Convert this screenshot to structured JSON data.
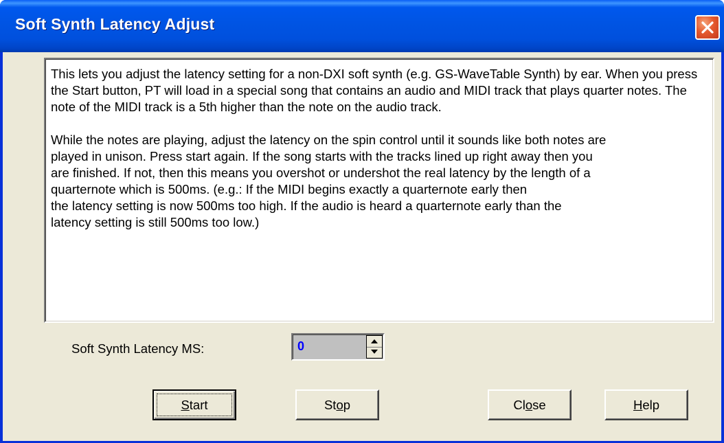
{
  "window": {
    "title": "Soft Synth Latency Adjust"
  },
  "icons": {
    "close": "close-icon",
    "spin_up": "arrow-up-icon",
    "spin_down": "arrow-down-icon"
  },
  "info": {
    "paragraph1": "This lets you adjust the latency setting for a non-DXI soft synth (e.g.  GS-WaveTable Synth) by ear. When you press the Start button, PT will load in a special song that contains an audio and MIDI track that plays quarter notes. The note of the MIDI track is a 5th higher than the note on the audio track.",
    "paragraph2_lines": [
      "While the notes are playing, adjust the latency on the spin control until it sounds like both notes are",
      "played in unison. Press start again. If the song starts with the tracks lined up right away  then you",
      "are finished.  If not, then this means you overshot or undershot the real latency  by the length of a",
      "quarternote which is 500ms.  (e.g.: If the MIDI begins exactly  a quarternote early then",
      "the latency setting is now 500ms too high.  If the audio is heard a quarternote early than the",
      "latency setting is still 500ms too low.)"
    ]
  },
  "latency": {
    "label": "Soft Synth Latency MS:",
    "value": "0"
  },
  "buttons": {
    "start": {
      "mnemonic": "S",
      "rest": "tart"
    },
    "stop": {
      "pre": "St",
      "mnemonic": "o",
      "rest": "p"
    },
    "close": {
      "pre": "Cl",
      "mnemonic": "o",
      "rest": "se"
    },
    "help": {
      "mnemonic": "H",
      "rest": "elp"
    }
  },
  "colors": {
    "title_bar": "#0054e3",
    "dialog_face": "#ece9d8",
    "close_button": "#e55a2e",
    "spin_value_text": "#0000ff"
  }
}
